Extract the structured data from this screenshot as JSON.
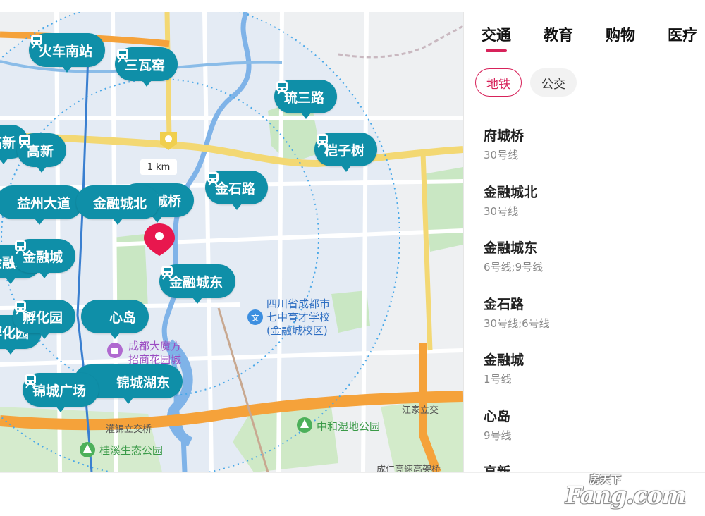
{
  "colors": {
    "pin": "#0f8fa8",
    "accent": "#d7225a",
    "park": "#c9e7c3",
    "water": "#7fb3e8",
    "ring_road": "#f5a23a",
    "main_road": "#f3d873"
  },
  "map": {
    "scale_label": "1 km",
    "pins": [
      {
        "name": "火车南站",
        "icon": "metro-icon"
      },
      {
        "name": "三瓦窑",
        "icon": "metro-icon"
      },
      {
        "name": "琉三路",
        "icon": "metro-icon"
      },
      {
        "name": "高新",
        "icon": "metro-icon"
      },
      {
        "name": "桤子树",
        "icon": "metro-icon"
      },
      {
        "name": "金石路",
        "icon": "metro-icon"
      },
      {
        "name": "益州大道",
        "icon": "metro-icon"
      },
      {
        "name": "金融城北",
        "icon": "metro-icon"
      },
      {
        "name": "府城桥",
        "icon": "metro-icon"
      },
      {
        "name": "金融城",
        "icon": "metro-icon"
      },
      {
        "name": "金融城东",
        "icon": "metro-icon"
      },
      {
        "name": "孵化园",
        "icon": "metro-icon"
      },
      {
        "name": "心岛",
        "icon": "metro-icon"
      },
      {
        "name": "锦城广场",
        "icon": "metro-icon"
      },
      {
        "name": "锦城湖东",
        "icon": "metro-icon"
      }
    ],
    "pois": {
      "school": "四川省成都市\n七中育才学校\n(金融城校区)",
      "mall": "成都大魔方\n招商花园城",
      "interchange_jiangjia": "江家立交",
      "interchange_guanjin": "灌锦立交桥",
      "park_zhonghe": "中和湿地公园",
      "park_guixi": "桂溪生态公园",
      "bridge": "成仁高速高架桥"
    }
  },
  "panel": {
    "tabs": [
      "交通",
      "教育",
      "购物",
      "医疗"
    ],
    "subtabs": [
      "地铁",
      "公交"
    ],
    "stations": [
      {
        "name": "府城桥",
        "lines": "30号线"
      },
      {
        "name": "金融城北",
        "lines": "30号线"
      },
      {
        "name": "金融城东",
        "lines": "6号线;9号线"
      },
      {
        "name": "金石路",
        "lines": "30号线;6号线"
      },
      {
        "name": "金融城",
        "lines": "1号线"
      },
      {
        "name": "心岛",
        "lines": "9号线"
      },
      {
        "name": "高新",
        "lines": ""
      }
    ]
  },
  "watermark": {
    "brand": "Fang.com",
    "tagline": "房天下"
  }
}
